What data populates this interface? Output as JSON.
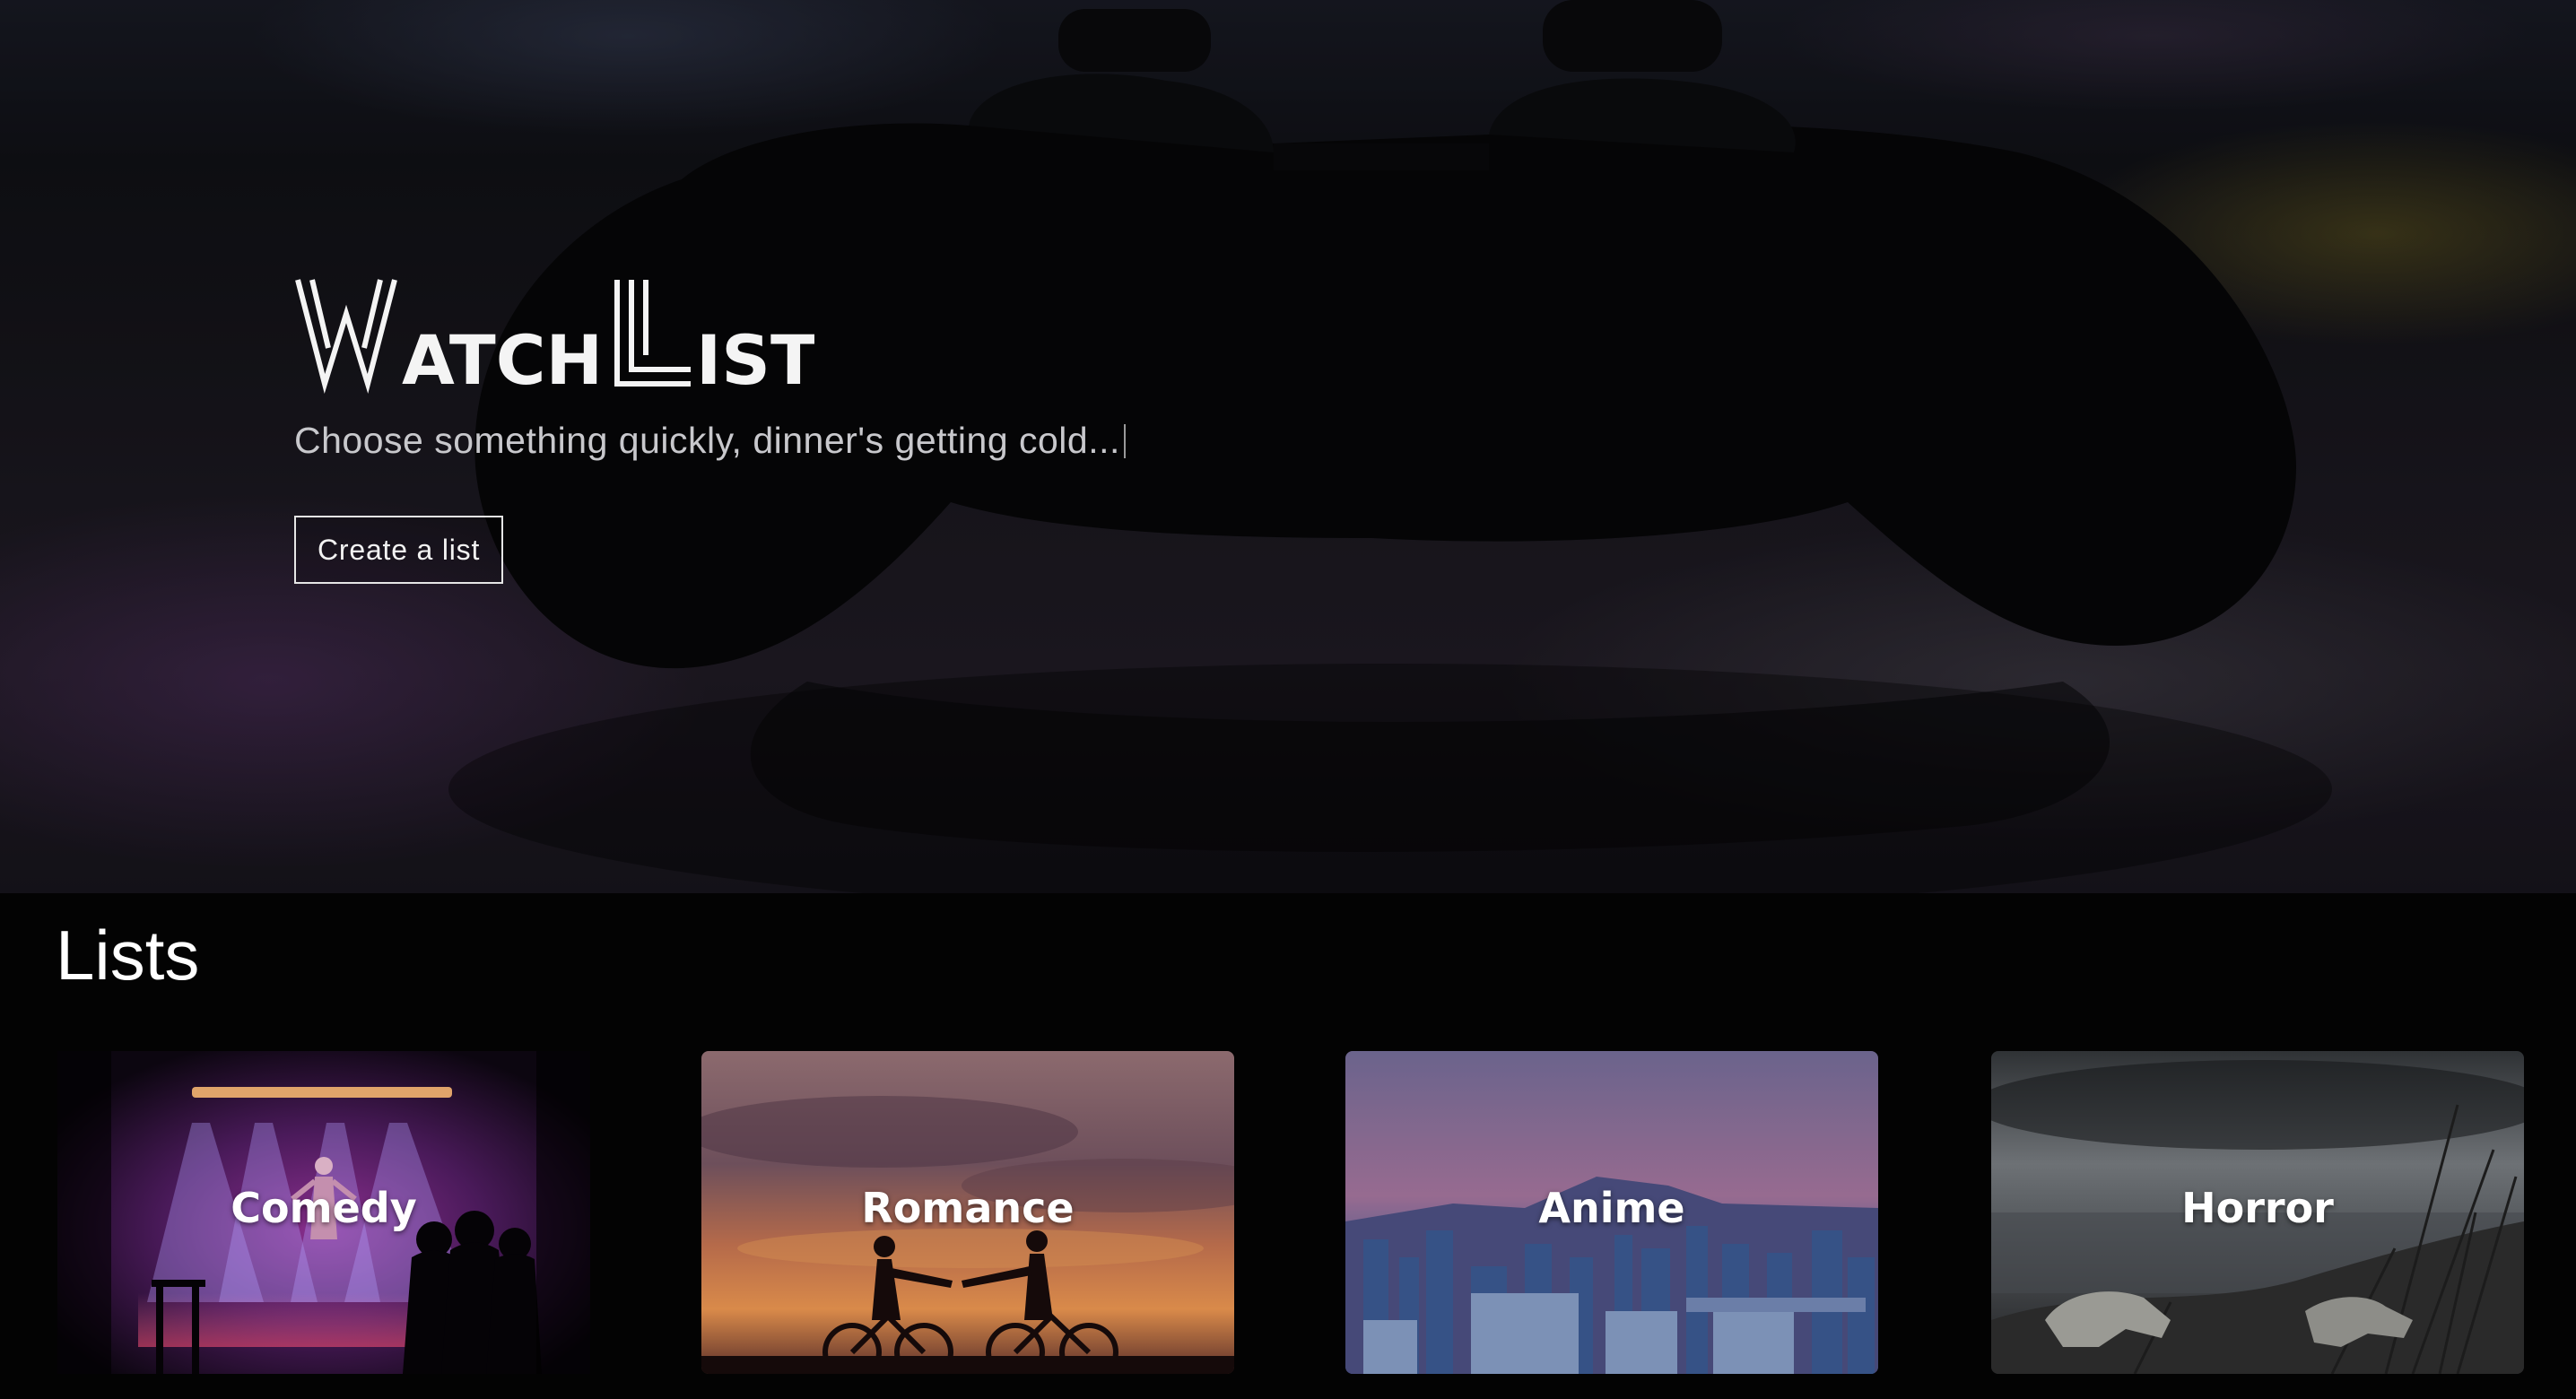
{
  "hero": {
    "logo_text": "WatchList",
    "tagline": "Choose something quickly, dinner's getting cold...",
    "create_button_label": "Create a list"
  },
  "lists": {
    "heading": "Lists",
    "items": [
      {
        "label": "Comedy"
      },
      {
        "label": "Romance"
      },
      {
        "label": "Anime"
      },
      {
        "label": "Horror"
      }
    ]
  }
}
